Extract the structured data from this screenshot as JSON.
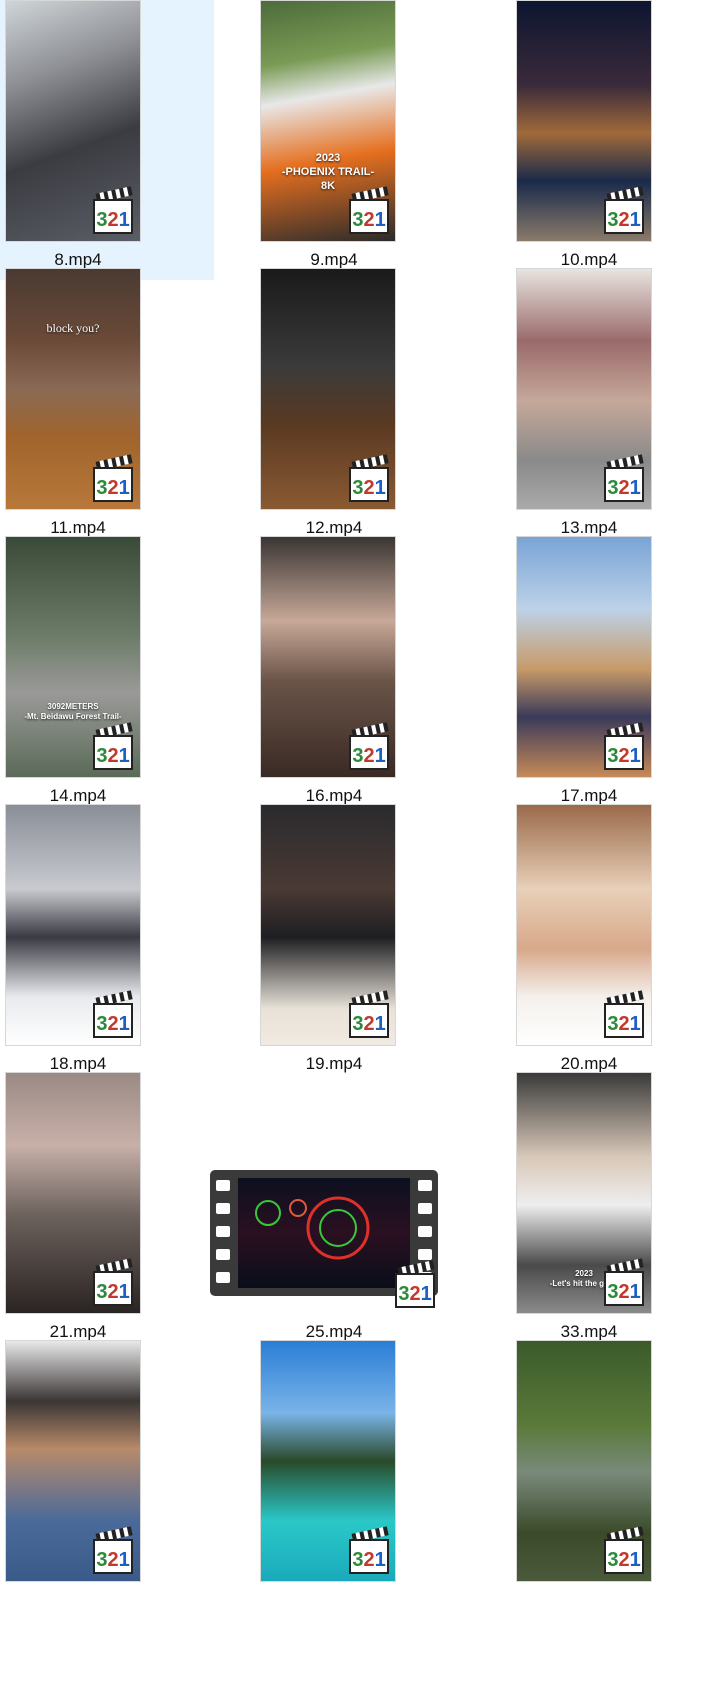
{
  "files": [
    {
      "name": "8.mp4",
      "selected": true,
      "overlay": ""
    },
    {
      "name": "9.mp4",
      "selected": false,
      "overlay": "2023\n-PHOENIX TRAIL-\n8K"
    },
    {
      "name": "10.mp4",
      "selected": false,
      "overlay": ""
    },
    {
      "name": "11.mp4",
      "selected": false,
      "overlay": "block you?"
    },
    {
      "name": "12.mp4",
      "selected": false,
      "overlay": ""
    },
    {
      "name": "13.mp4",
      "selected": false,
      "overlay": ""
    },
    {
      "name": "14.mp4",
      "selected": false,
      "overlay": "3092METERS\n-Mt. Beidawu Forest Trail-"
    },
    {
      "name": "16.mp4",
      "selected": false,
      "overlay": ""
    },
    {
      "name": "17.mp4",
      "selected": false,
      "overlay": ""
    },
    {
      "name": "18.mp4",
      "selected": false,
      "overlay": ""
    },
    {
      "name": "19.mp4",
      "selected": false,
      "overlay": ""
    },
    {
      "name": "20.mp4",
      "selected": false,
      "overlay": ""
    },
    {
      "name": "21.mp4",
      "selected": false,
      "overlay": ""
    },
    {
      "name": "25.mp4",
      "selected": false,
      "overlay": ""
    },
    {
      "name": "33.mp4",
      "selected": false,
      "overlay": "2023\n-Let's hit the gym-"
    },
    {
      "name": "",
      "selected": false,
      "overlay": ""
    },
    {
      "name": "",
      "selected": false,
      "overlay": ""
    },
    {
      "name": "",
      "selected": false,
      "overlay": ""
    }
  ],
  "badge_label": "321",
  "icons": {
    "thumbnail_badge": "media-player-classic-clapperboard-icon",
    "landscape_frame": "film-strip-icon"
  },
  "colors": {
    "selection": "#e5f3ff",
    "badge_3": "#2a8a3a",
    "badge_2": "#c0392b",
    "badge_1": "#1f5fbf"
  }
}
